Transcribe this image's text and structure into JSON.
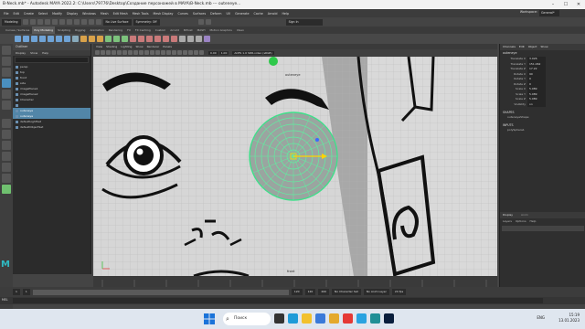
{
  "window": {
    "title": "B-Neck.mb* - Autodesk MAYA 2022.2: C:\\Users\\79776\\Desktop\\Создание персонажей в MAYA\\B-Neck.mb   ---   outeneye..."
  },
  "menubar": {
    "items": [
      "File",
      "Edit",
      "Create",
      "Select",
      "Modify",
      "Display",
      "Windows",
      "Mesh",
      "Edit Mesh",
      "Mesh Tools",
      "Mesh Display",
      "Curves",
      "Surfaces",
      "Deform",
      "UV",
      "Generate",
      "Cache",
      "Arnold",
      "Help"
    ],
    "workspace_label": "Workspace:",
    "workspace_value": "General*"
  },
  "statusline": {
    "mode": "Modeling",
    "live_surface": "No Live Surface",
    "symmetry": "Symmetry: Off",
    "signin": "Sign In"
  },
  "shelf_tabs": [
    "Curves / Surfaces",
    "Poly Modeling",
    "Sculpting",
    "Rigging",
    "Animation",
    "Rendering",
    "FX",
    "FX Caching",
    "Custom",
    "Arnold",
    "Bifrost",
    "MASH",
    "Motion Graphics",
    "XGen"
  ],
  "shelf_tab_active": 1,
  "outliner": {
    "title": "Outliner",
    "menu": [
      "Display",
      "Show",
      "Help"
    ],
    "items": [
      "persp",
      "top",
      "front",
      "side",
      "imagePlane1",
      "imagePlane2",
      "Character",
      "",
      "outeneye",
      "outeneye",
      "defaultLightSet",
      "defaultObjectSet"
    ],
    "selected": [
      8,
      9
    ]
  },
  "viewport": {
    "menu": [
      "View",
      "Shading",
      "Lighting",
      "Show",
      "Renderer",
      "Panels"
    ],
    "field_a": "0.00",
    "field_b": "1.00",
    "colorspace": "ACES 1.0 SDR-video (sRGB)",
    "camera_label": "front",
    "sel_label": "outeneye"
  },
  "channelbox": {
    "header": [
      "Channels",
      "Edit",
      "Object",
      "Show"
    ],
    "object": "outeneye",
    "attrs": [
      {
        "name": "Translate X",
        "value": "3.026"
      },
      {
        "name": "Translate Y",
        "value": "151.062"
      },
      {
        "name": "Translate Z",
        "value": "17.22"
      },
      {
        "name": "Rotate X",
        "value": "90"
      },
      {
        "name": "Rotate Y",
        "value": "0"
      },
      {
        "name": "Rotate Z",
        "value": "0"
      },
      {
        "name": "Scale X",
        "value": "5.089"
      },
      {
        "name": "Scale Y",
        "value": "5.089"
      },
      {
        "name": "Scale Z",
        "value": "5.089"
      },
      {
        "name": "Visibility",
        "value": "on"
      }
    ],
    "shapes_label": "SHAPES",
    "shape_name": "outeneyeShape",
    "inputs_label": "INPUTS",
    "input_name": "polySphere1",
    "display_title": "Display",
    "display_tab2": "Anim",
    "display_menu": [
      "Layers",
      "Options",
      "Help"
    ]
  },
  "range": {
    "start": "1",
    "start2": "1",
    "end": "120",
    "end2": "120",
    "end3": "200",
    "character_set": "No Character Set",
    "anim_layer": "No Anim Layer",
    "fps": "24 fps"
  },
  "mel": {
    "label": "MEL"
  },
  "taskbar": {
    "search": "Поиск",
    "tray_lang": "ENG",
    "time": "15:19",
    "date": "13.01.2023"
  }
}
